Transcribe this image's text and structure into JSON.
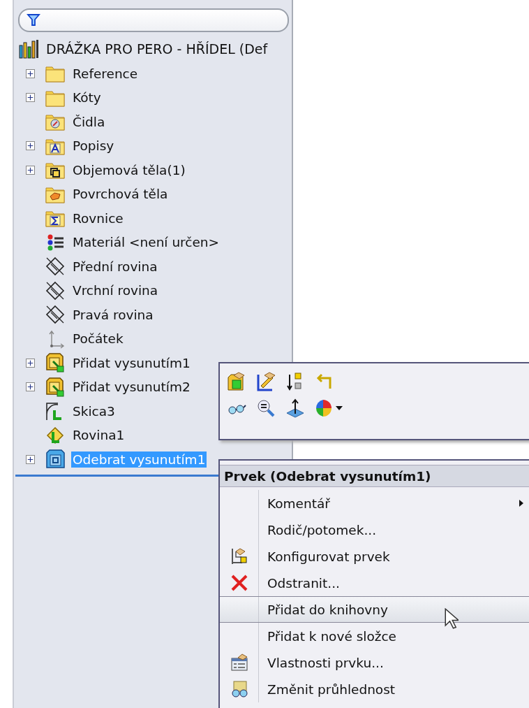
{
  "tree": {
    "root": {
      "label": "DRÁŽKA PRO PERO - HŘÍDEL  (Def",
      "children": [
        {
          "label": "Reference",
          "kind": "folder",
          "expandable": true,
          "selected": false
        },
        {
          "label": "Kóty",
          "kind": "folder",
          "expandable": true,
          "selected": false
        },
        {
          "label": "Čidla",
          "kind": "sensor-folder",
          "expandable": false,
          "selected": false
        },
        {
          "label": "Popisy",
          "kind": "annotation-folder",
          "expandable": true,
          "selected": false
        },
        {
          "label": "Objemová těla(1)",
          "kind": "solid-folder",
          "expandable": true,
          "selected": false
        },
        {
          "label": "Povrchová těla",
          "kind": "surface-folder",
          "expandable": false,
          "selected": false
        },
        {
          "label": "Rovnice",
          "kind": "equation-folder",
          "expandable": false,
          "selected": false
        },
        {
          "label": "Materiál <není určen>",
          "kind": "material",
          "expandable": false,
          "selected": false
        },
        {
          "label": "Přední rovina",
          "kind": "plane",
          "expandable": false,
          "selected": false
        },
        {
          "label": "Vrchní rovina",
          "kind": "plane",
          "expandable": false,
          "selected": false
        },
        {
          "label": "Pravá rovina",
          "kind": "plane",
          "expandable": false,
          "selected": false
        },
        {
          "label": "Počátek",
          "kind": "origin",
          "expandable": false,
          "selected": false
        },
        {
          "label": "Přidat vysunutím1",
          "kind": "extrude",
          "expandable": true,
          "selected": false
        },
        {
          "label": "Přidat vysunutím2",
          "kind": "extrude",
          "expandable": true,
          "selected": false
        },
        {
          "label": "Skica3",
          "kind": "sketch",
          "expandable": false,
          "selected": false
        },
        {
          "label": "Rovina1",
          "kind": "ref-plane",
          "expandable": false,
          "selected": false
        },
        {
          "label": "Odebrat vysunutím1",
          "kind": "cut-extrude",
          "expandable": true,
          "selected": true
        }
      ]
    }
  },
  "context_menu": {
    "title": "Prvek (Odebrat vysunutím1)",
    "items": [
      {
        "label": "Komentář",
        "kind": "plain",
        "submenu": true,
        "selected": false
      },
      {
        "label": "Rodič/potomek...",
        "kind": "plain",
        "submenu": false,
        "selected": false
      },
      {
        "label": "Konfigurovat prvek",
        "kind": "configure",
        "submenu": false,
        "selected": false
      },
      {
        "label": "Odstranit...",
        "kind": "delete",
        "submenu": false,
        "selected": false
      },
      {
        "label": "Přidat do knihovny",
        "kind": "plain",
        "submenu": false,
        "selected": true
      },
      {
        "label": "Přidat k nové složce",
        "kind": "plain",
        "submenu": false,
        "selected": false
      },
      {
        "label": "Vlastnosti prvku...",
        "kind": "properties",
        "submenu": false,
        "selected": false
      },
      {
        "label": "Změnit průhlednost",
        "kind": "transparency",
        "submenu": false,
        "selected": false
      }
    ]
  }
}
